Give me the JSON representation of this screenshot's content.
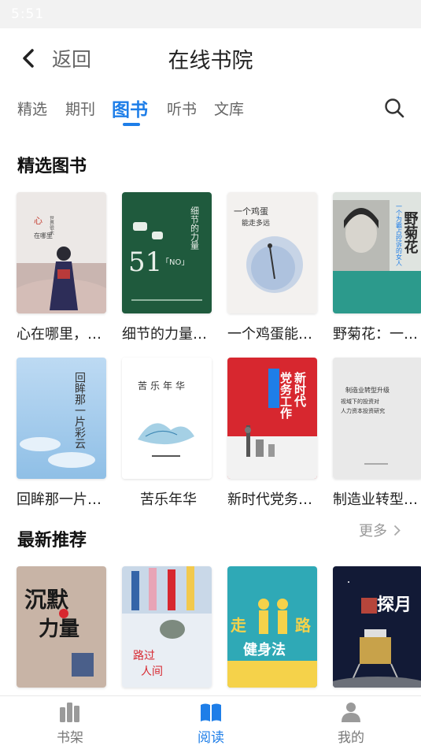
{
  "status": {
    "time": "5:51"
  },
  "header": {
    "back_label": "返回",
    "title": "在线书院"
  },
  "tabs": [
    {
      "label": "精选"
    },
    {
      "label": "期刊"
    },
    {
      "label": "图书"
    },
    {
      "label": "听书"
    },
    {
      "label": "文库"
    }
  ],
  "active_tab": "图书",
  "sections": {
    "featured": {
      "title": "精选图书"
    },
    "latest": {
      "title": "最新推荐",
      "more_label": "更多"
    }
  },
  "featured_books": [
    {
      "title": "心在哪里，…",
      "cover_text": "心在哪里"
    },
    {
      "title": "细节的力量…",
      "cover_text": "细节的力量",
      "cover_number": "51",
      "cover_badge": "「NO」"
    },
    {
      "title": "一个鸡蛋能…",
      "cover_text": "一个鸡蛋能走多远"
    },
    {
      "title": "野菊花：一…",
      "cover_text": "野菊花"
    },
    {
      "title": "回眸那一片…",
      "cover_text": "回眸那一片彩云"
    },
    {
      "title": "苦乐年华",
      "cover_text": "苦乐年华"
    },
    {
      "title": "新时代党务…",
      "cover_text": "新时代党务工作"
    },
    {
      "title": "制造业转型…",
      "cover_text": "制造业转型升级"
    }
  ],
  "latest_books": [
    {
      "cover_text": "沉默的力量"
    },
    {
      "cover_text": "路过人间"
    },
    {
      "cover_text": "走路健身法"
    },
    {
      "cover_text": "探月"
    }
  ],
  "bottom_nav": [
    {
      "label": "书架",
      "icon": "bookshelf-icon"
    },
    {
      "label": "阅读",
      "icon": "open-book-icon"
    },
    {
      "label": "我的",
      "icon": "user-icon"
    }
  ],
  "active_nav": "阅读",
  "colors": {
    "accent": "#1e7ee8",
    "muted": "#666666",
    "divider": "#e8e8e8"
  }
}
